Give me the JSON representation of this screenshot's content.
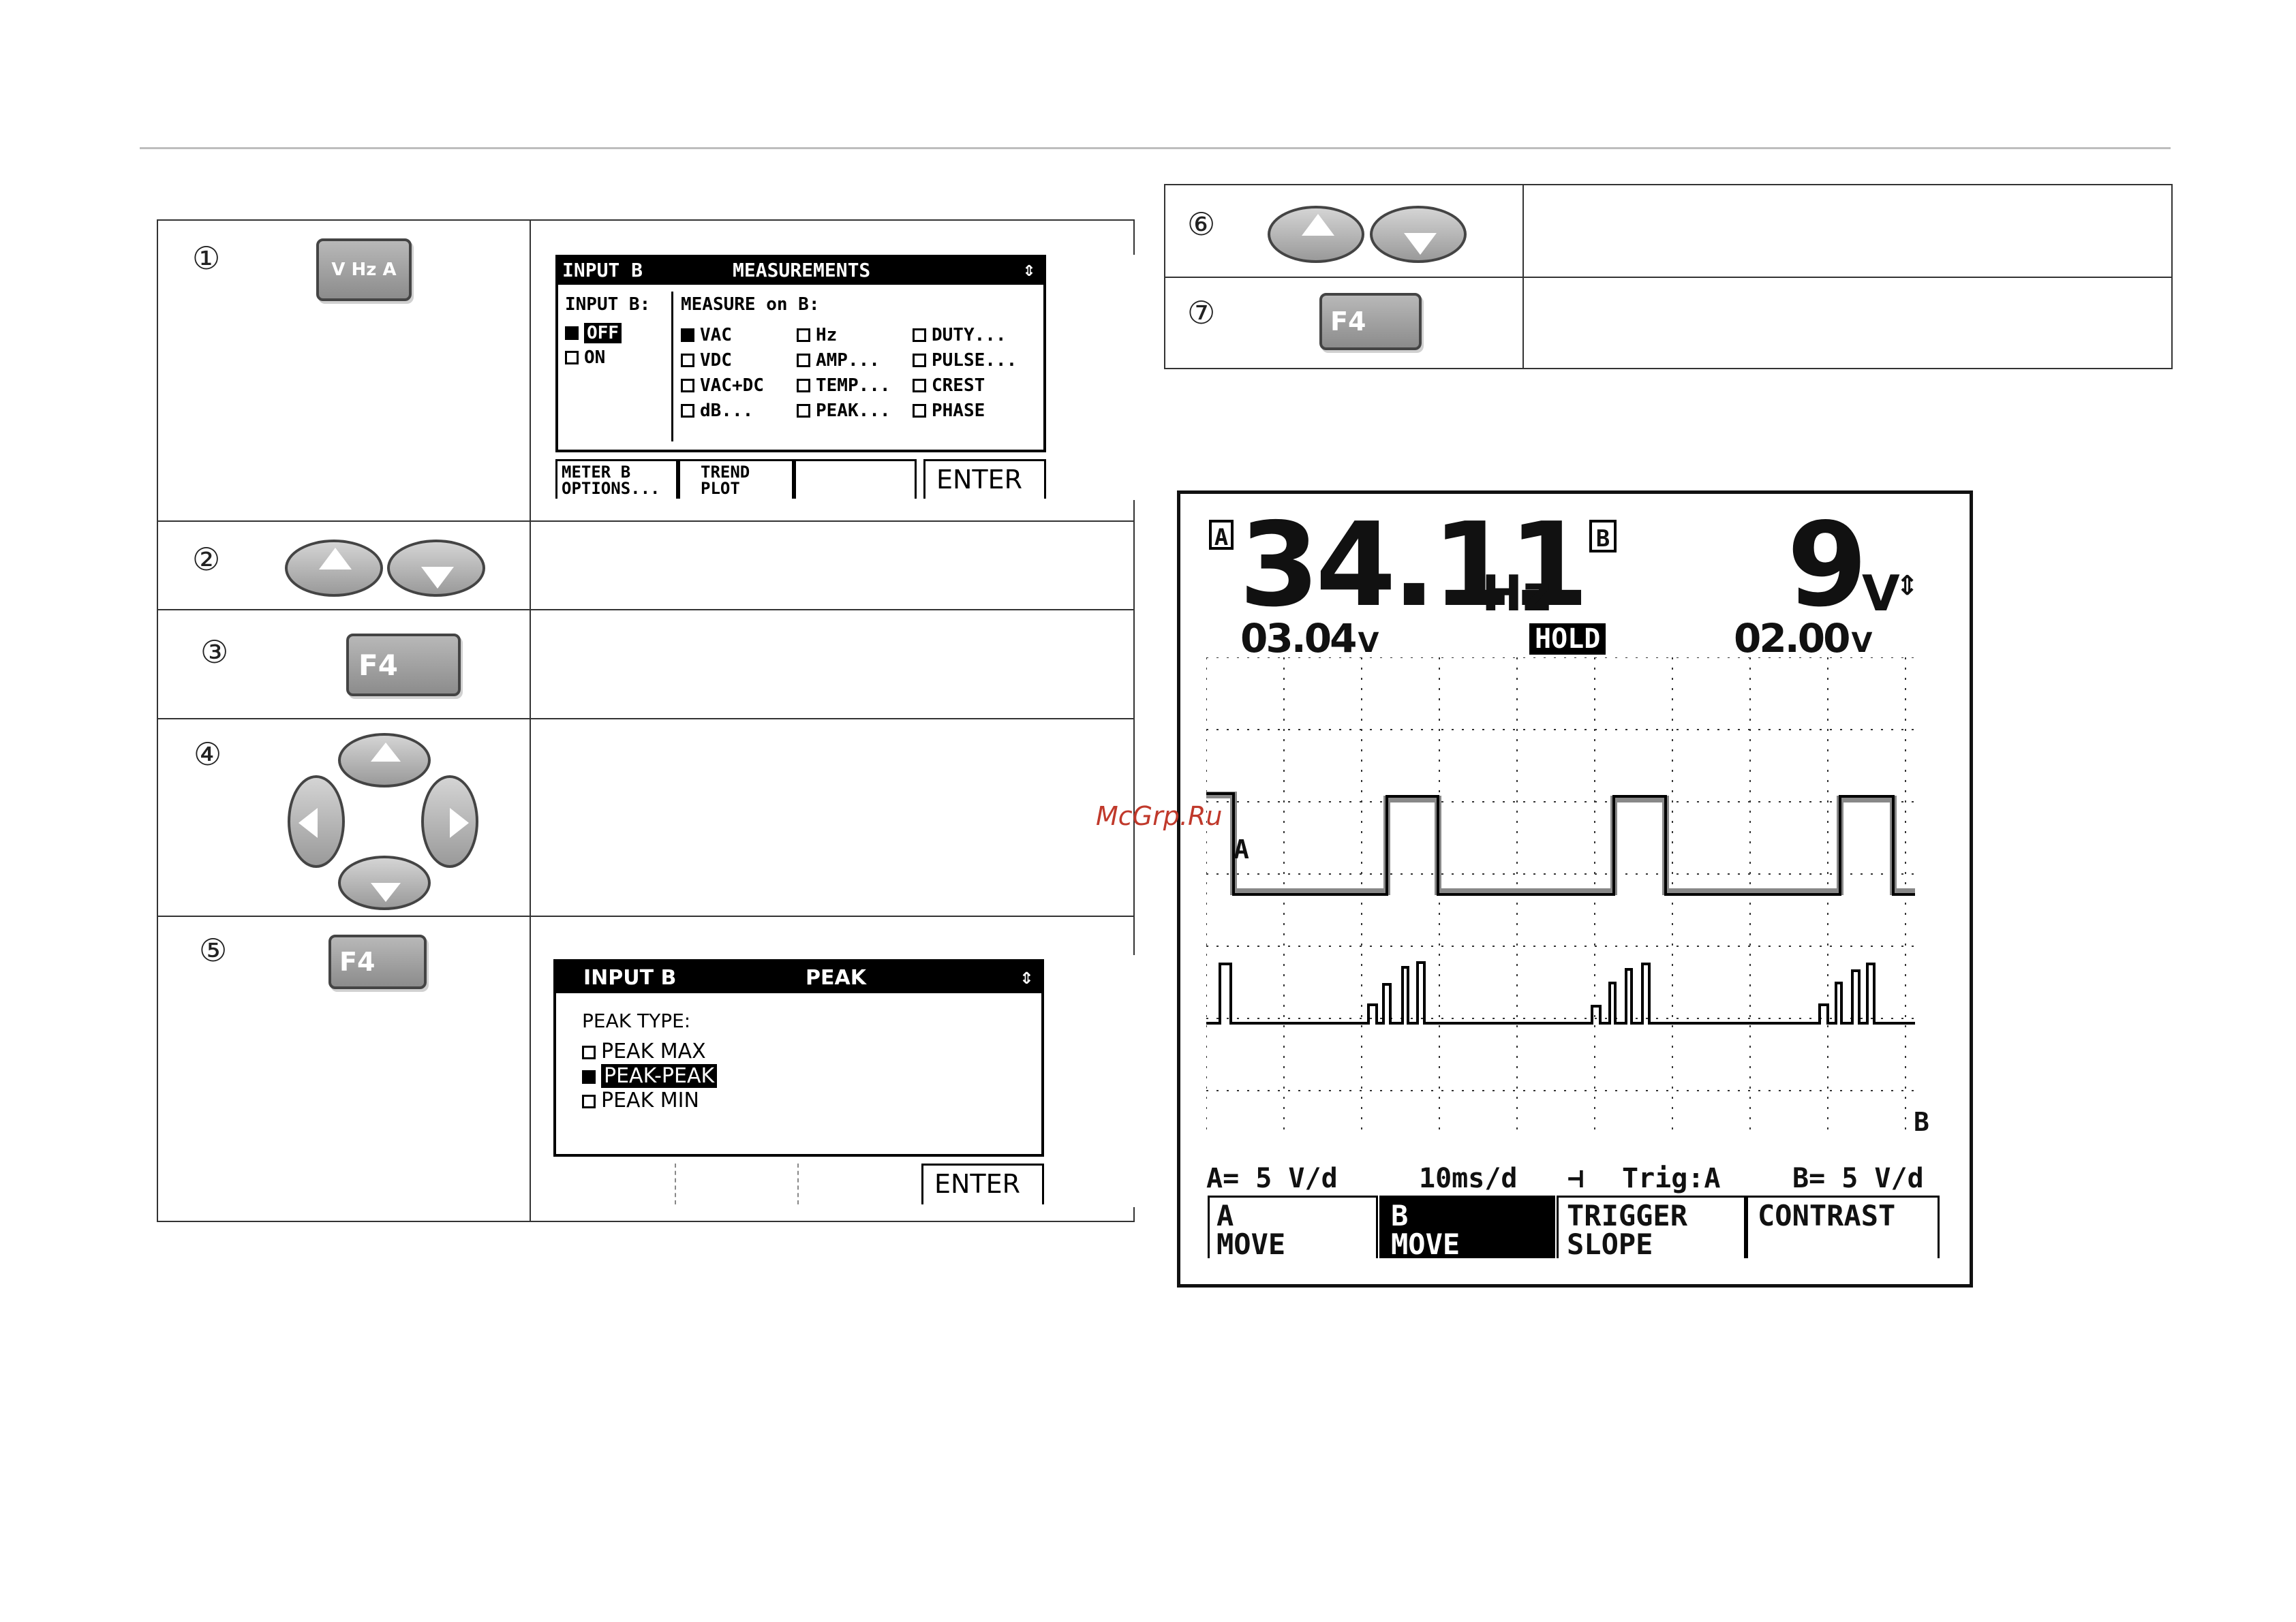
{
  "steps": {
    "s1": {
      "num": "①",
      "key_label": "V Hz A"
    },
    "s2": {
      "num": "②"
    },
    "s3": {
      "num": "③",
      "key_label": "F4"
    },
    "s4": {
      "num": "④"
    },
    "s5": {
      "num": "⑤",
      "key_label": "F4"
    },
    "s6": {
      "num": "⑥"
    },
    "s7": {
      "num": "⑦",
      "key_label": "F4"
    }
  },
  "measurements_screen": {
    "title_left": "INPUT B",
    "title_center": "MEASUREMENTS",
    "col1_header": "INPUT B:",
    "col1_items": [
      "OFF",
      "ON"
    ],
    "col2_header": "MEASURE on B:",
    "grid": [
      [
        "VAC",
        "Hz",
        "DUTY..."
      ],
      [
        "VDC",
        "AMP...",
        "PULSE..."
      ],
      [
        "VAC+DC",
        "TEMP...",
        "CREST"
      ],
      [
        "dB...",
        "PEAK...",
        "PHASE"
      ]
    ],
    "fkeys": [
      "METER B OPTIONS...",
      "TREND PLOT",
      "",
      "ENTER"
    ]
  },
  "peak_screen": {
    "title_left": "INPUT B",
    "title_center": "PEAK",
    "header": "PEAK TYPE:",
    "options": [
      "PEAK MAX",
      "PEAK-PEAK",
      "PEAK MIN"
    ],
    "fkeys": [
      "",
      "",
      "",
      "ENTER"
    ]
  },
  "scope": {
    "a_tag": "A",
    "b_tag": "B",
    "main_a": "34.11",
    "unit_a": "Hz",
    "main_b": "9",
    "unit_b": "V",
    "sub_a": "03.04",
    "sub_a_unit": "V",
    "hold": "HOLD",
    "sub_b": "02.00",
    "sub_b_unit": "V",
    "trace_a_label": "A",
    "trace_b_label": "B",
    "status": {
      "a": "A= 5 V/d",
      "time": "10ms/d",
      "trig": "Trig:A",
      "b": "B= 5 V/d"
    },
    "fkeys": [
      {
        "line1": "A",
        "line2": "MOVE"
      },
      {
        "line1": "B",
        "line2": "MOVE"
      },
      {
        "line1": "TRIGGER",
        "line2": "SLOPE"
      },
      {
        "line1": "CONTRAST",
        "line2": ""
      }
    ]
  },
  "watermark": "McGrp.Ru"
}
